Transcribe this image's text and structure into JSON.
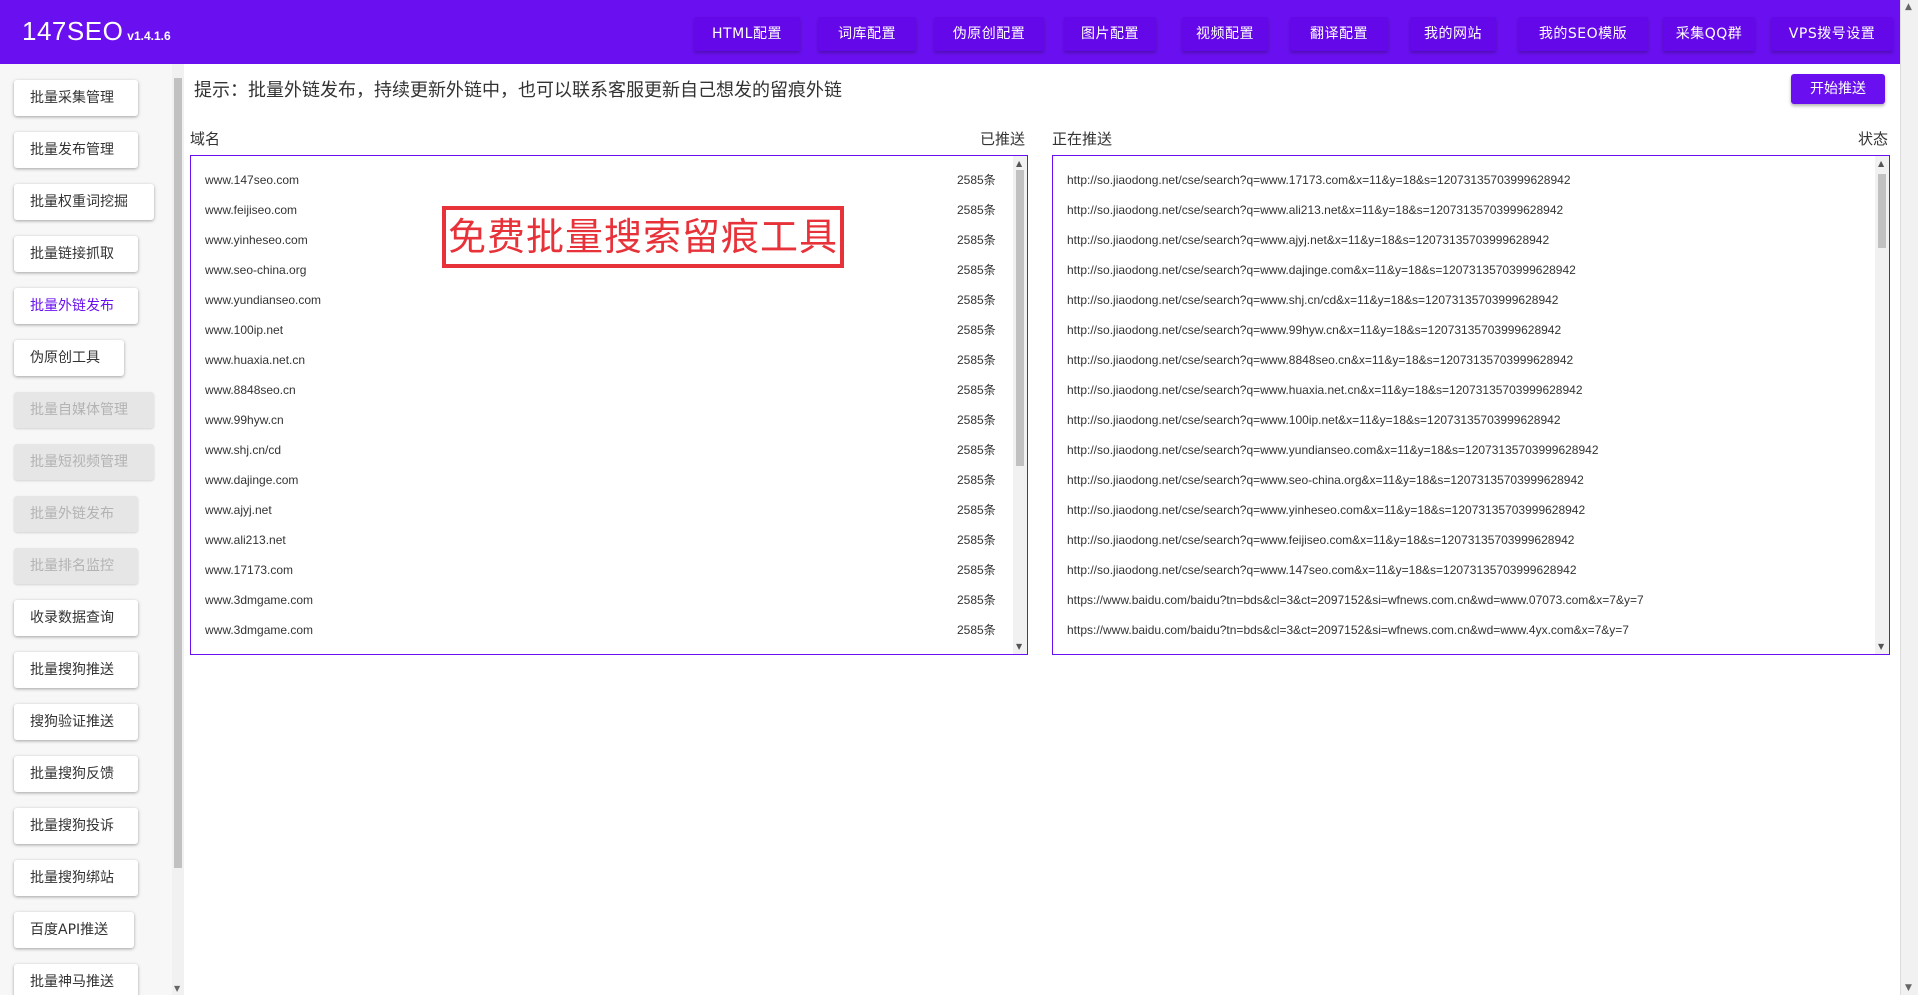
{
  "header": {
    "brand_name": "147SEO",
    "version": "v1.4.1.6",
    "nav": [
      "HTML配置",
      "词库配置",
      "伪原创配置",
      "图片配置",
      "视频配置",
      "翻译配置",
      "我的网站",
      "我的SEO模版",
      "采集QQ群",
      "VPS拨号设置"
    ]
  },
  "sidebar": {
    "items": [
      {
        "label": "批量采集管理",
        "state": "normal"
      },
      {
        "label": "批量发布管理",
        "state": "normal"
      },
      {
        "label": "批量权重词挖掘",
        "state": "normal"
      },
      {
        "label": "批量链接抓取",
        "state": "normal"
      },
      {
        "label": "批量外链发布",
        "state": "active"
      },
      {
        "label": "伪原创工具",
        "state": "normal"
      },
      {
        "label": "批量自媒体管理",
        "state": "disabled"
      },
      {
        "label": "批量短视频管理",
        "state": "disabled"
      },
      {
        "label": "批量外链发布",
        "state": "disabled"
      },
      {
        "label": "批量排名监控",
        "state": "disabled"
      },
      {
        "label": "收录数据查询",
        "state": "normal"
      },
      {
        "label": "批量搜狗推送",
        "state": "normal"
      },
      {
        "label": "搜狗验证推送",
        "state": "normal"
      },
      {
        "label": "批量搜狗反馈",
        "state": "normal"
      },
      {
        "label": "批量搜狗投诉",
        "state": "normal"
      },
      {
        "label": "批量搜狗绑站",
        "state": "normal"
      },
      {
        "label": "百度API推送",
        "state": "normal"
      },
      {
        "label": "批量神马推送",
        "state": "normal"
      }
    ]
  },
  "main": {
    "tip": "提示：批量外链发布，持续更新外链中，也可以联系客服更新自己想发的留痕外链",
    "start_button": "开始推送",
    "promo": "免费批量搜索留痕工具",
    "left_panel": {
      "col_domain": "域名",
      "col_pushed": "已推送",
      "rows": [
        {
          "domain": "www.147seo.com",
          "count": "2585条"
        },
        {
          "domain": "www.feijiseo.com",
          "count": "2585条"
        },
        {
          "domain": "www.yinheseo.com",
          "count": "2585条"
        },
        {
          "domain": "www.seo-china.org",
          "count": "2585条"
        },
        {
          "domain": "www.yundianseo.com",
          "count": "2585条"
        },
        {
          "domain": "www.100ip.net",
          "count": "2585条"
        },
        {
          "domain": "www.huaxia.net.cn",
          "count": "2585条"
        },
        {
          "domain": "www.8848seo.cn",
          "count": "2585条"
        },
        {
          "domain": "www.99hyw.cn",
          "count": "2585条"
        },
        {
          "domain": "www.shj.cn/cd",
          "count": "2585条"
        },
        {
          "domain": "www.dajinge.com",
          "count": "2585条"
        },
        {
          "domain": "www.ajyj.net",
          "count": "2585条"
        },
        {
          "domain": "www.ali213.net",
          "count": "2585条"
        },
        {
          "domain": "www.17173.com",
          "count": "2585条"
        },
        {
          "domain": "www.3dmgame.com",
          "count": "2585条"
        },
        {
          "domain": "www.3dmgame.com",
          "count": "2585条"
        }
      ]
    },
    "right_panel": {
      "col_pushing": "正在推送",
      "col_status": "状态",
      "rows": [
        "http://so.jiaodong.net/cse/search?q=www.17173.com&x=11&y=18&s=12073135703999628942",
        "http://so.jiaodong.net/cse/search?q=www.ali213.net&x=11&y=18&s=12073135703999628942",
        "http://so.jiaodong.net/cse/search?q=www.ajyj.net&x=11&y=18&s=12073135703999628942",
        "http://so.jiaodong.net/cse/search?q=www.dajinge.com&x=11&y=18&s=12073135703999628942",
        "http://so.jiaodong.net/cse/search?q=www.shj.cn/cd&x=11&y=18&s=12073135703999628942",
        "http://so.jiaodong.net/cse/search?q=www.99hyw.cn&x=11&y=18&s=12073135703999628942",
        "http://so.jiaodong.net/cse/search?q=www.8848seo.cn&x=11&y=18&s=12073135703999628942",
        "http://so.jiaodong.net/cse/search?q=www.huaxia.net.cn&x=11&y=18&s=12073135703999628942",
        "http://so.jiaodong.net/cse/search?q=www.100ip.net&x=11&y=18&s=12073135703999628942",
        "http://so.jiaodong.net/cse/search?q=www.yundianseo.com&x=11&y=18&s=12073135703999628942",
        "http://so.jiaodong.net/cse/search?q=www.seo-china.org&x=11&y=18&s=12073135703999628942",
        "http://so.jiaodong.net/cse/search?q=www.yinheseo.com&x=11&y=18&s=12073135703999628942",
        "http://so.jiaodong.net/cse/search?q=www.feijiseo.com&x=11&y=18&s=12073135703999628942",
        "http://so.jiaodong.net/cse/search?q=www.147seo.com&x=11&y=18&s=12073135703999628942",
        "https://www.baidu.com/baidu?tn=bds&cl=3&ct=2097152&si=wfnews.com.cn&wd=www.07073.com&x=7&y=7",
        "https://www.baidu.com/baidu?tn=bds&cl=3&ct=2097152&si=wfnews.com.cn&wd=www.4yx.com&x=7&y=7"
      ]
    }
  },
  "colors": {
    "brand": "#6a10f0",
    "promo_red": "#e8323a",
    "disabled_bg": "#e6e6e6"
  }
}
